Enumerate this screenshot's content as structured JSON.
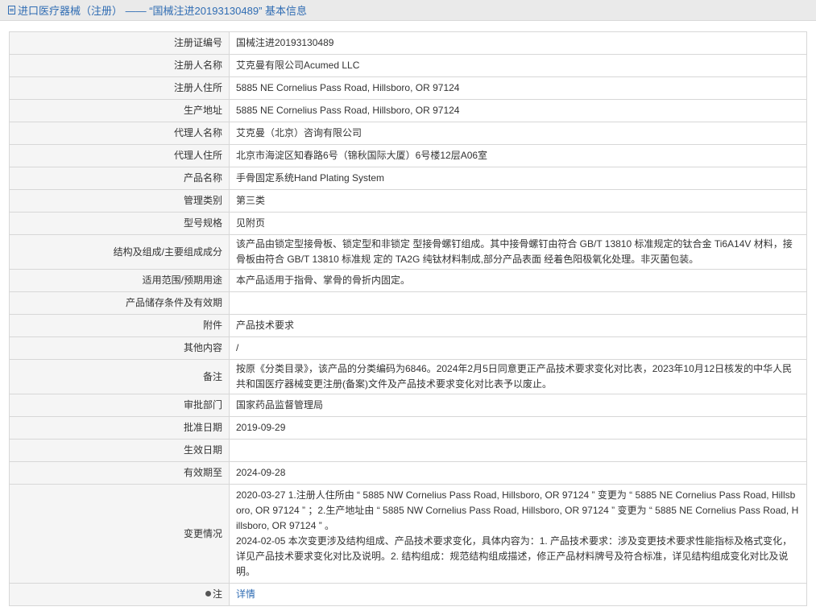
{
  "header": {
    "title": "进口医疗器械（注册） —— “国械注进20193130489” 基本信息"
  },
  "rows": [
    {
      "label": "注册证编号",
      "value": "国械注进20193130489"
    },
    {
      "label": "注册人名称",
      "value": "艾克曼有限公司Acumed LLC"
    },
    {
      "label": "注册人住所",
      "value": "5885 NE Cornelius Pass Road, Hillsboro, OR 97124"
    },
    {
      "label": "生产地址",
      "value": "5885 NE Cornelius Pass Road, Hillsboro, OR 97124"
    },
    {
      "label": "代理人名称",
      "value": "艾克曼（北京）咨询有限公司"
    },
    {
      "label": "代理人住所",
      "value": "北京市海淀区知春路6号（锦秋国际大厦）6号楼12层A06室"
    },
    {
      "label": "产品名称",
      "value": "手骨固定系统Hand Plating System"
    },
    {
      "label": "管理类别",
      "value": "第三类"
    },
    {
      "label": "型号规格",
      "value": "见附页"
    },
    {
      "label": "结构及组成/主要组成成分",
      "value": "该产品由锁定型接骨板、锁定型和非锁定 型接骨螺钉组成。其中接骨螺钉由符合 GB/T 13810 标准规定的钛合金 Ti6A14V 材料，接骨板由符合 GB/T 13810 标准规 定的 TA2G 纯钛材料制成,部分产品表面 经着色阳极氧化处理。非灭菌包装。"
    },
    {
      "label": "适用范围/预期用途",
      "value": "本产品适用于指骨、掌骨的骨折内固定。"
    },
    {
      "label": "产品储存条件及有效期",
      "value": ""
    },
    {
      "label": "附件",
      "value": "产品技术要求"
    },
    {
      "label": "其他内容",
      "value": "/"
    },
    {
      "label": "备注",
      "value": "按原《分类目录》，该产品的分类编码为6846。2024年2月5日同意更正产品技术要求变化对比表，2023年10月12日核发的中华人民共和国医疗器械变更注册(备案)文件及产品技术要求变化对比表予以废止。"
    },
    {
      "label": "审批部门",
      "value": "国家药品监督管理局"
    },
    {
      "label": "批准日期",
      "value": "2019-09-29"
    },
    {
      "label": "生效日期",
      "value": ""
    },
    {
      "label": "有效期至",
      "value": "2024-09-28"
    }
  ],
  "change": {
    "label": "变更情况",
    "lines": [
      "2020-03-27 1.注册人住所由 “ 5885 NW Cornelius Pass Road, Hillsboro, OR 97124 ” 变更为 “ 5885 NE Cornelius Pass Road, Hillsboro, OR 97124 ” ；2.生产地址由 “ 5885 NW Cornelius Pass Road, Hillsboro, OR 97124 ” 变更为 “ 5885 NE Cornelius Pass Road, Hillsboro, OR 97124 ” 。",
      "2024-02-05 本次变更涉及结构组成、产品技术要求变化，具体内容为：1. 产品技术要求：涉及变更技术要求性能指标及格式变化，详见产品技术要求变化对比及说明。2. 结构组成：规范结构组成描述，修正产品材料牌号及符合标准，详见结构组成变化对比及说明。"
    ]
  },
  "note": {
    "label": "注",
    "link": "详情",
    "icon": "pin-icon"
  }
}
